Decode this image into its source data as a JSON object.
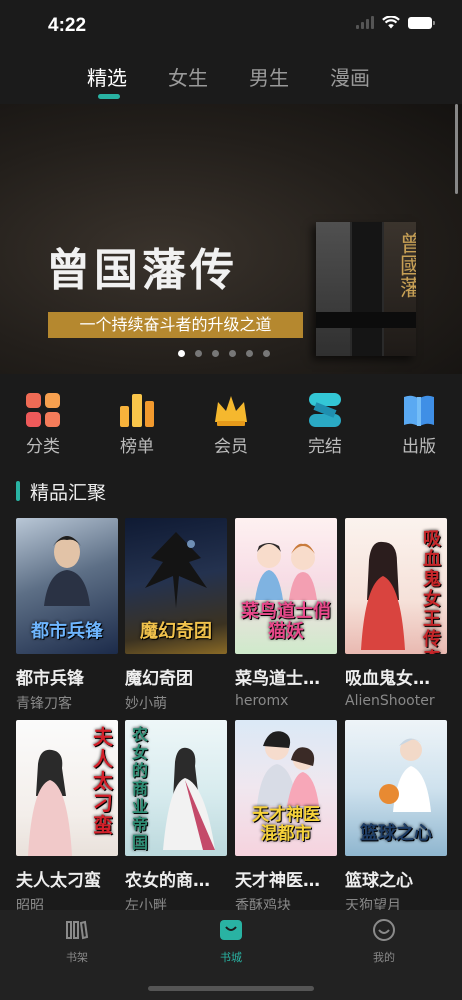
{
  "status": {
    "time": "4:22"
  },
  "tabs": [
    {
      "label": "精选",
      "active": true
    },
    {
      "label": "女生",
      "active": false
    },
    {
      "label": "男生",
      "active": false
    },
    {
      "label": "漫画",
      "active": false
    }
  ],
  "banner": {
    "title": "曾国藩传",
    "subtitle": "一个持续奋斗者的升级之道",
    "book_cover_text": "曾國藩",
    "dots_count": 6,
    "active_dot": 0
  },
  "quick_nav": [
    {
      "label": "分类",
      "icon": "category-grid-icon"
    },
    {
      "label": "榜单",
      "icon": "ranking-bars-icon"
    },
    {
      "label": "会员",
      "icon": "vip-crown-icon"
    },
    {
      "label": "完结",
      "icon": "completed-s-icon"
    },
    {
      "label": "出版",
      "icon": "published-book-icon"
    }
  ],
  "section": {
    "title": "精品汇聚"
  },
  "books": [
    {
      "title": "都市兵锋",
      "author": "青锋刀客",
      "cover_text": "都市兵锋"
    },
    {
      "title": "魔幻奇团",
      "author": "妙小萌",
      "cover_text": "魔幻奇团"
    },
    {
      "title": "菜鸟道士…",
      "author": "heromx",
      "cover_text": "菜鸟道士俏猫妖"
    },
    {
      "title": "吸血鬼女…",
      "author": "AlienShooter",
      "cover_text": "吸血鬼女王传奇"
    },
    {
      "title": "夫人太刁蛮",
      "author": "昭昭",
      "cover_text": "夫人太刁蛮"
    },
    {
      "title": "农女的商…",
      "author": "左小畔",
      "cover_text": "农女的商业帝国"
    },
    {
      "title": "天才神医…",
      "author": "香酥鸡块",
      "cover_text": "天才神医 混都市"
    },
    {
      "title": "篮球之心",
      "author": "天狗望月",
      "cover_text": "篮球之心"
    }
  ],
  "bottom_nav": [
    {
      "label": "书架",
      "icon": "bookshelf-icon",
      "active": false
    },
    {
      "label": "书城",
      "icon": "bookstore-bag-icon",
      "active": true
    },
    {
      "label": "我的",
      "icon": "profile-smile-icon",
      "active": false
    }
  ],
  "colors": {
    "accent": "#29b3a3",
    "background": "#1b1b1b",
    "gold": "#b5882f"
  }
}
